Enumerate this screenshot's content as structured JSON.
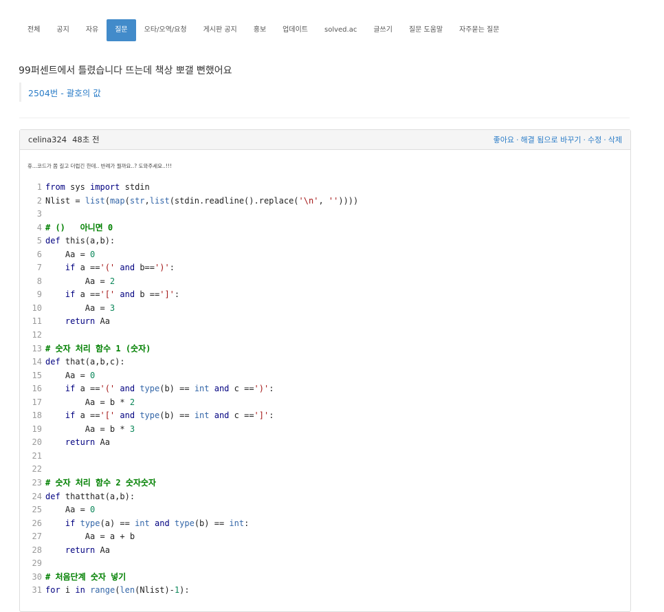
{
  "nav": {
    "tabs": [
      "전체",
      "공지",
      "자유",
      "질문",
      "오타/오역/요청",
      "게시판 공지",
      "홍보",
      "업데이트",
      "solved.ac",
      "글쓰기",
      "질문 도움말",
      "자주묻는 질문"
    ],
    "active_index": 3
  },
  "post": {
    "title": "99퍼센트에서 틀렸습니다 뜨는데 책상 뽀갤 뻔했어요",
    "problem_link": "2504번 - 괄호의 값",
    "author": "celina324",
    "time": "48초 전",
    "actions": [
      "좋아요",
      "해결 됨으로 바꾸기",
      "수정",
      "삭제"
    ],
    "body": "휴...코드가 쫌 길고 더럽긴 한데.. 반례가 뭘까요..? 도와주세요..!!!"
  },
  "code_lines": [
    "from sys import stdin",
    "Nlist = list(map(str,list(stdin.readline().replace('\\n', ''))))",
    "",
    "# ()   아니면 0",
    "def this(a,b):",
    "    Aa = 0",
    "    if a =='(' and b==')':",
    "        Aa = 2",
    "    if a =='[' and b ==']':",
    "        Aa = 3",
    "    return Aa",
    "",
    "# 숫자 처리 함수 1 (숫자)",
    "def that(a,b,c):",
    "    Aa = 0",
    "    if a =='(' and type(b) == int and c ==')':",
    "        Aa = b * 2",
    "    if a =='[' and type(b) == int and c ==']':",
    "        Aa = b * 3",
    "    return Aa",
    "",
    "",
    "# 숫자 처리 함수 2 숫자숫자",
    "def thatthat(a,b):",
    "    Aa = 0",
    "    if type(a) == int and type(b) == int:",
    "        Aa = a + b",
    "    return Aa",
    "",
    "# 처음단계 숫자 넣기",
    "for i in range(len(Nlist)-1):"
  ]
}
